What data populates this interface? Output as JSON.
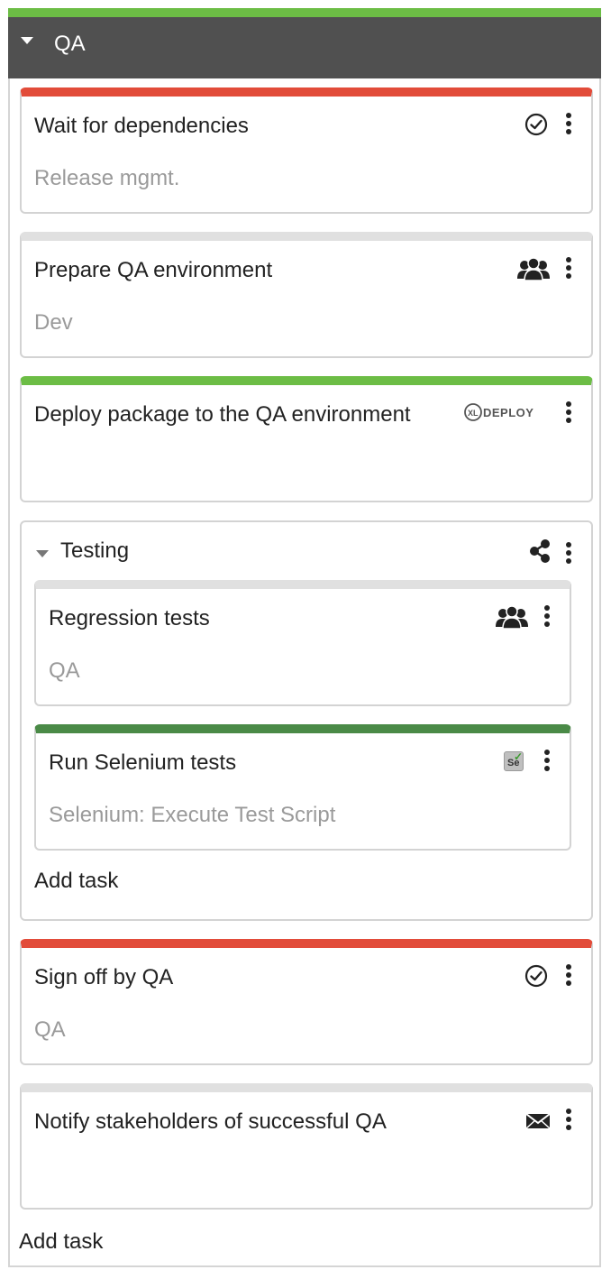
{
  "phase": {
    "title": "QA"
  },
  "tasks": [
    {
      "title": "Wait for dependencies",
      "subtitle": "Release mgmt.",
      "icon": "check-circle-icon",
      "status_color": "#e24c3a"
    },
    {
      "title": "Prepare QA environment",
      "subtitle": "Dev",
      "icon": "team-icon",
      "status_color": "#e0e0e0"
    },
    {
      "title": "Deploy package to the QA environment",
      "subtitle": "",
      "icon": "xl-deploy-logo",
      "icon_text": "DEPLOY",
      "icon_badge": "XL",
      "status_color": "#6cbd45"
    }
  ],
  "group": {
    "title": "Testing",
    "icon": "share-icon",
    "tasks": [
      {
        "title": "Regression tests",
        "subtitle": "QA",
        "icon": "team-icon",
        "status_color": "#e0e0e0"
      },
      {
        "title": "Run Selenium tests",
        "subtitle": "Selenium: Execute Test Script",
        "icon": "selenium-icon",
        "icon_text": "Se",
        "status_color": "#4a8a47"
      }
    ],
    "add_task_label": "Add task"
  },
  "tasks_after": [
    {
      "title": "Sign off by QA",
      "subtitle": "QA",
      "icon": "check-circle-icon",
      "status_color": "#e24c3a"
    },
    {
      "title": "Notify stakeholders of successful QA",
      "subtitle": "",
      "icon": "envelope-icon",
      "status_color": "#e0e0e0"
    }
  ],
  "add_task_label": "Add task"
}
